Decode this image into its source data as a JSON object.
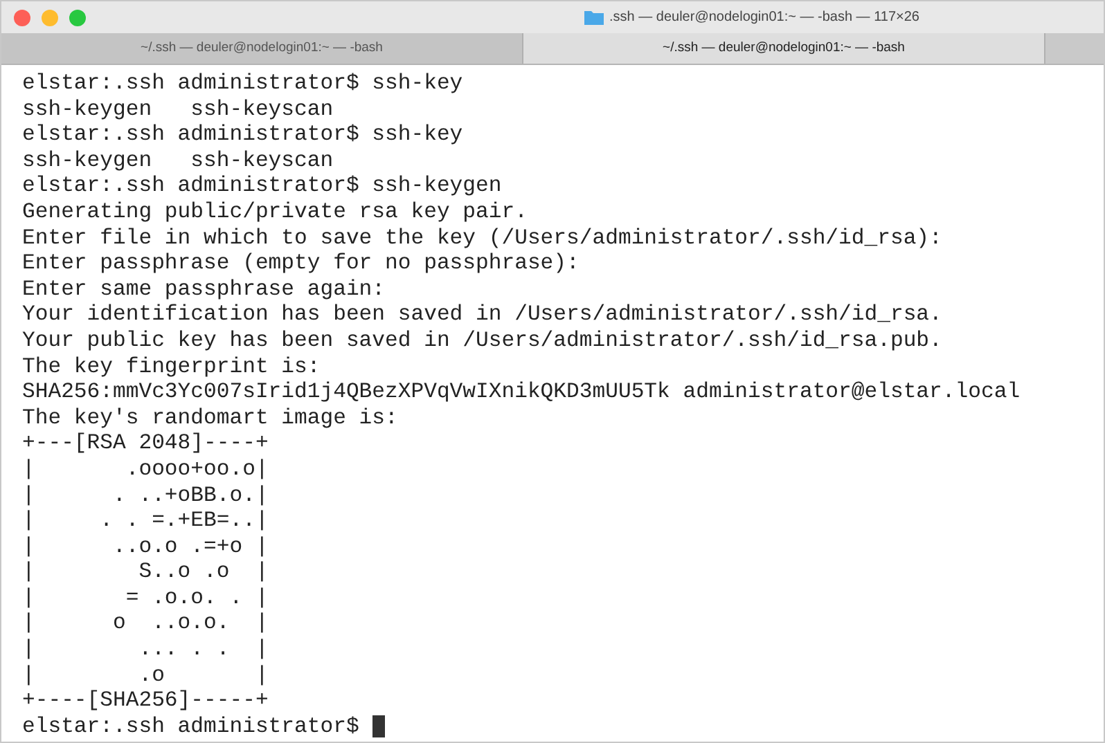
{
  "window": {
    "title": ".ssh — deuler@nodelogin01:~ — -bash — 117×26"
  },
  "tabs": [
    {
      "label": "~/.ssh — deuler@nodelogin01:~ — -bash",
      "selected": false
    },
    {
      "label": "~/.ssh — deuler@nodelogin01:~ — -bash",
      "selected": true
    }
  ],
  "terminal": {
    "lines": [
      "elstar:.ssh administrator$ ssh-key",
      "ssh-keygen   ssh-keyscan",
      "elstar:.ssh administrator$ ssh-key",
      "ssh-keygen   ssh-keyscan",
      "elstar:.ssh administrator$ ssh-keygen",
      "Generating public/private rsa key pair.",
      "Enter file in which to save the key (/Users/administrator/.ssh/id_rsa):",
      "Enter passphrase (empty for no passphrase):",
      "Enter same passphrase again:",
      "Your identification has been saved in /Users/administrator/.ssh/id_rsa.",
      "Your public key has been saved in /Users/administrator/.ssh/id_rsa.pub.",
      "The key fingerprint is:",
      "SHA256:mmVc3Yc007sIrid1j4QBezXPVqVwIXnikQKD3mUU5Tk administrator@elstar.local",
      "The key's randomart image is:",
      "+---[RSA 2048]----+",
      "|       .oooo+oo.o|",
      "|      . ..+oBB.o.|",
      "|     . . =.+EB=..|",
      "|      ..o.o .=+o |",
      "|        S..o .o  |",
      "|       = .o.o. . |",
      "|      o  ..o.o.  |",
      "|        ... . .  |",
      "|        .o       |",
      "+----[SHA256]-----+"
    ],
    "prompt": "elstar:.ssh administrator$ "
  }
}
